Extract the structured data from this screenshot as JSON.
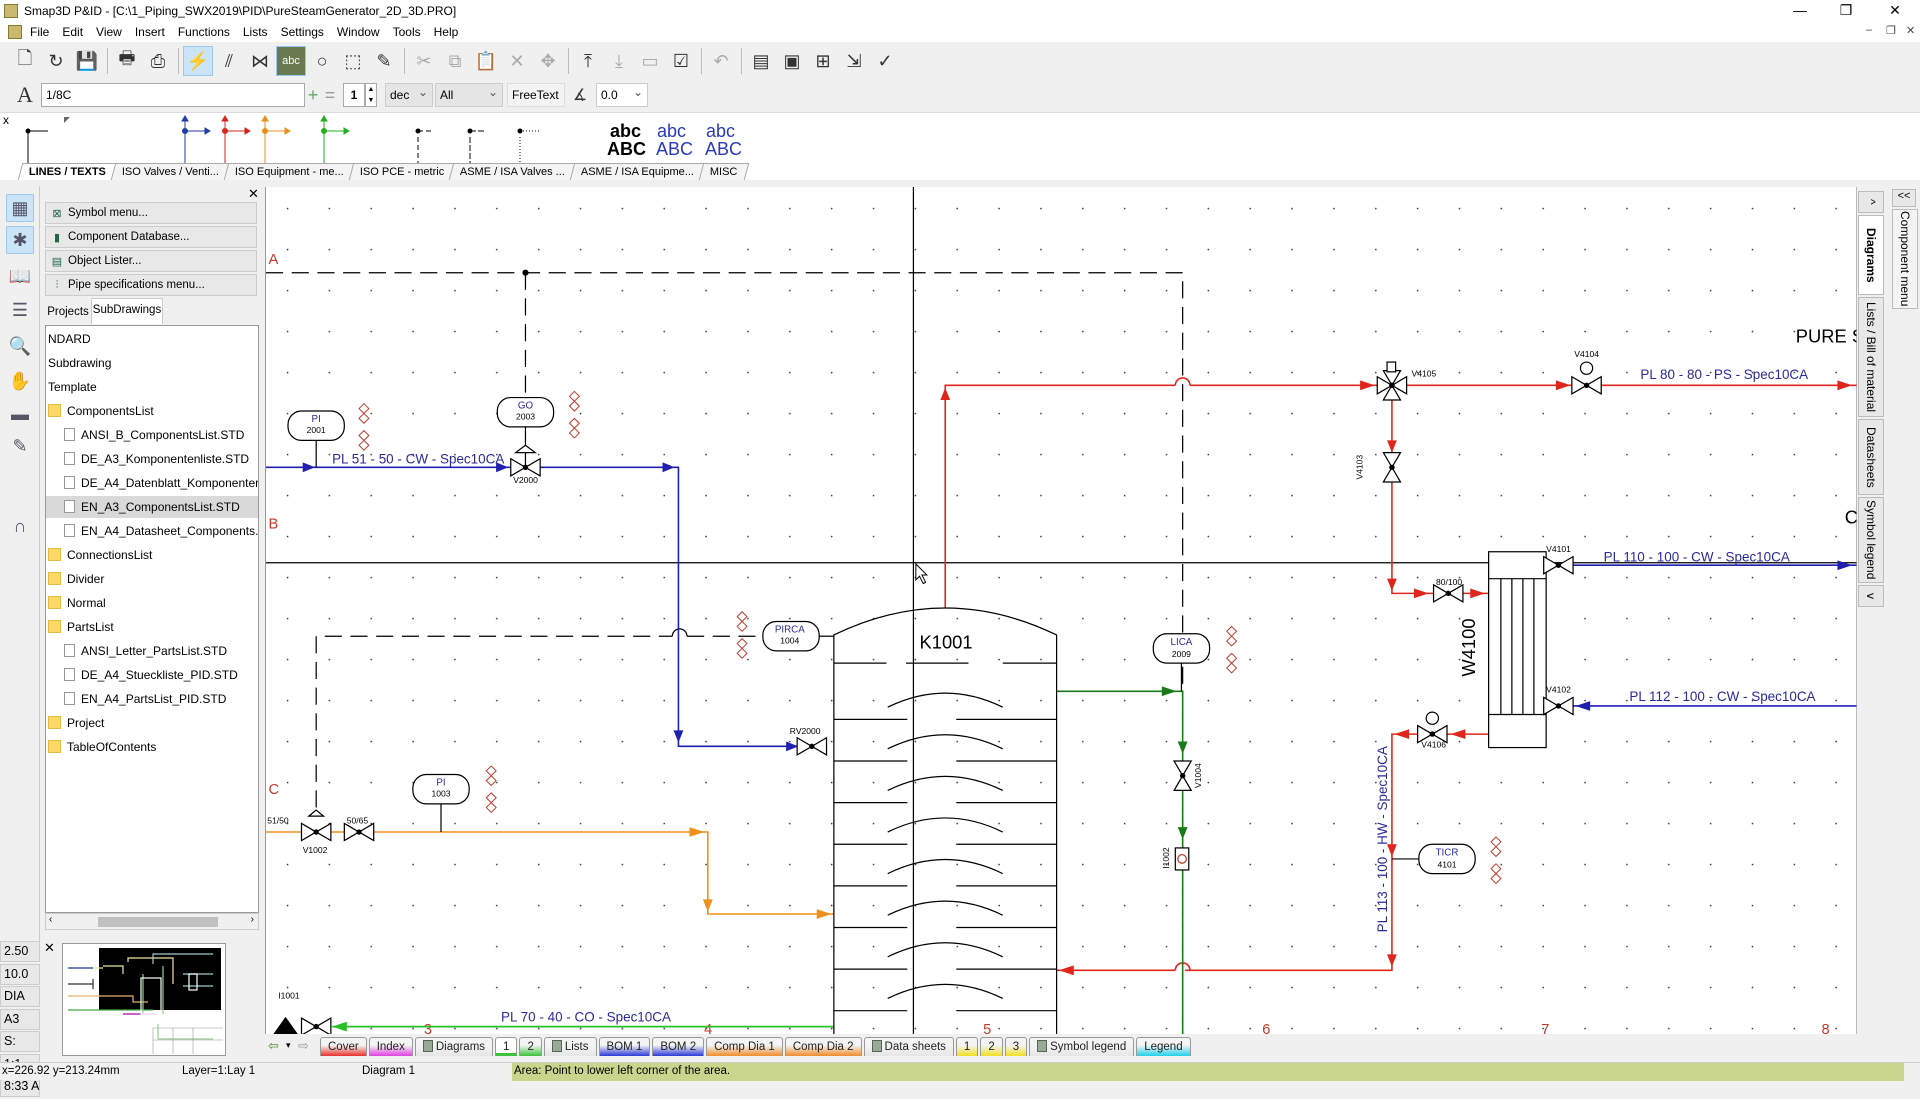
{
  "window": {
    "title": "Smap3D P&ID - [C:\\1_Piping_SWX2019\\PID\\PureSteamGenerator_2D_3D.PRO]",
    "minimize": "—",
    "restore": "❐",
    "close": "✕"
  },
  "menu": [
    "File",
    "Edit",
    "View",
    "Insert",
    "Functions",
    "Lists",
    "Settings",
    "Window",
    "Tools",
    "Help"
  ],
  "toolbar": {
    "icons": [
      {
        "name": "new-document-icon",
        "glyph": "🗋"
      },
      {
        "name": "open-icon",
        "glyph": "↻"
      },
      {
        "name": "save-icon",
        "glyph": "💾"
      },
      {
        "sep": true
      },
      {
        "name": "print-icon",
        "glyph": "🖶"
      },
      {
        "name": "print-preview-icon",
        "glyph": "⎙"
      },
      {
        "sep": true
      },
      {
        "name": "pipe-draw-icon",
        "glyph": "⚡",
        "active": true
      },
      {
        "name": "parallel-lines-icon",
        "glyph": "⫽"
      },
      {
        "name": "valve-icon",
        "glyph": "⋈"
      },
      {
        "name": "text-abc-icon",
        "glyph": "abc",
        "active": true
      },
      {
        "name": "circle-icon",
        "glyph": "○"
      },
      {
        "name": "select-area-icon",
        "glyph": "⬚"
      },
      {
        "name": "pencil-icon",
        "glyph": "✎"
      },
      {
        "sep": true
      },
      {
        "name": "cut-icon",
        "glyph": "✂",
        "dis": true
      },
      {
        "name": "copy-icon",
        "glyph": "⧉",
        "dis": true
      },
      {
        "name": "paste-icon",
        "glyph": "📋"
      },
      {
        "name": "delete-icon",
        "glyph": "✕",
        "dis": true
      },
      {
        "name": "move-icon",
        "glyph": "✥",
        "dis": true
      },
      {
        "sep": true
      },
      {
        "name": "pipe-up-icon",
        "glyph": "⤒"
      },
      {
        "name": "pipe-down-icon",
        "glyph": "⤓",
        "dis": true
      },
      {
        "name": "rectangle-icon",
        "glyph": "▭",
        "dis": true
      },
      {
        "name": "checklist-icon",
        "glyph": "☑"
      },
      {
        "sep": true
      },
      {
        "name": "undo-icon",
        "glyph": "↶",
        "dis": true
      },
      {
        "sep": true
      },
      {
        "name": "document-list-icon",
        "glyph": "▤"
      },
      {
        "name": "database-icon",
        "glyph": "▣"
      },
      {
        "name": "insert-component-icon",
        "glyph": "⊞"
      },
      {
        "name": "export-icon",
        "glyph": "⇲"
      },
      {
        "name": "spellcheck-icon",
        "glyph": "✓"
      }
    ],
    "text_style": "1/8C",
    "counter": "1",
    "number_format": "dec",
    "layer_filter": "All",
    "freetext_label": "FreeText",
    "angle": "0.0"
  },
  "palette": {
    "close": "x",
    "tabs": [
      "LINES / TEXTS",
      "ISO Valves / Venti...",
      "ISO Equipment - me...",
      "ISO PCE - metric",
      "ASME / ISA Valves ...",
      "ASME / ISA Equipme...",
      "MISC"
    ],
    "active_tab": 0,
    "text_samples": [
      {
        "top": "abc",
        "bottom": "ABC"
      },
      {
        "top": "abc",
        "bottom": "ABC"
      },
      {
        "top": "abc",
        "bottom": "ABC"
      }
    ],
    "line_colors": [
      "#000000",
      "#1f3fa8",
      "#d9261c",
      "#e8901c",
      "#22b022"
    ]
  },
  "left_panel": {
    "close": "✕",
    "menu_buttons": [
      "Symbol menu...",
      "Component Database...",
      "Object Lister...",
      "Pipe specifications menu..."
    ],
    "tabs": [
      "Projects",
      "SubDrawings"
    ],
    "active_tab": 1,
    "tree": [
      {
        "label": "NDARD",
        "type": "text",
        "level": 0
      },
      {
        "label": "Subdrawing",
        "type": "text",
        "level": 0
      },
      {
        "label": "Template",
        "type": "text",
        "level": 0
      },
      {
        "label": "ComponentsList",
        "type": "folder",
        "level": 0
      },
      {
        "label": "ANSI_B_ComponentsList.STD",
        "type": "file",
        "level": 1
      },
      {
        "label": "DE_A3_Komponentenliste.STD",
        "type": "file",
        "level": 1
      },
      {
        "label": "DE_A4_Datenblatt_Komponenten",
        "type": "file",
        "level": 1
      },
      {
        "label": "EN_A3_ComponentsList.STD",
        "type": "file",
        "level": 1,
        "selected": true
      },
      {
        "label": "EN_A4_Datasheet_Components.s",
        "type": "file",
        "level": 1
      },
      {
        "label": "ConnectionsList",
        "type": "folder",
        "level": 0
      },
      {
        "label": "Divider",
        "type": "folder",
        "level": 0
      },
      {
        "label": "Normal",
        "type": "folder",
        "level": 0
      },
      {
        "label": "PartsList",
        "type": "folder",
        "level": 0
      },
      {
        "label": "ANSI_Letter_PartsList.STD",
        "type": "file",
        "level": 1
      },
      {
        "label": "DE_A4_Stueckliste_PID.STD",
        "type": "file",
        "level": 1
      },
      {
        "label": "EN_A4_PartsList_PID.STD",
        "type": "file",
        "level": 1
      },
      {
        "label": "Project",
        "type": "folder",
        "level": 0
      },
      {
        "label": "TableOfContents",
        "type": "folder",
        "level": 0
      }
    ]
  },
  "side_values": [
    "2.50",
    "10.0",
    "DIA",
    "A3",
    "S:",
    "1:1",
    "8:33 A"
  ],
  "overview_close": "✕",
  "right_tabs": {
    "up": "^",
    "down": "v",
    "tabs": [
      "Diagrams",
      "Lists / Bill of material",
      "Datasheets",
      "Symbol legend"
    ],
    "active": 0,
    "collapse": "<<",
    "component_menu": "Component menu"
  },
  "drawing": {
    "rows": [
      "A",
      "B",
      "C"
    ],
    "columns": [
      "3",
      "4",
      "5",
      "6",
      "7",
      "8"
    ],
    "title_fragment": "PURE S",
    "row_fragment": "C",
    "equipment": {
      "column": "K1001",
      "heat_exchanger": "W4100"
    },
    "pipelines": {
      "pl51": "PL 51 - 50 - CW - Spec10CA",
      "pl80": "PL 80 - 80 - PS - Spec10CA",
      "pl110": "PL 110 - 100 - CW - Spec10CA",
      "pl112": "PL 112 - 100 - CW - Spec10CA",
      "pl113": "PL 113 - 100 - HW - Spec10CA",
      "pl70": "PL 70 - 40 - CO - Spec10CA"
    },
    "instruments": {
      "pi2001": {
        "tag": "PI",
        "num": "2001"
      },
      "go2003": {
        "tag": "GO",
        "num": "2003"
      },
      "pirca1004": {
        "tag": "PIRCA",
        "num": "1004"
      },
      "lica2009": {
        "tag": "LICA",
        "num": "2009"
      },
      "pi1003": {
        "tag": "PI",
        "num": "1003"
      },
      "ticr4101": {
        "tag": "TICR",
        "num": "4101"
      }
    },
    "valves": {
      "v2000": "V2000",
      "v4105": "V4105",
      "v4104": "V4104",
      "v4103": "V4103",
      "v4101": "V4101",
      "v4102": "V4102",
      "v4106": "V4106",
      "rv2000": "RV2000",
      "v1004": "V1004",
      "i1002": "I1002",
      "v1002": "V1002",
      "i1001": "I1001",
      "red8100": "80/100",
      "red5065": "50/65",
      "red5150": "51/50"
    },
    "colors": {
      "cw": "#1f1fb0",
      "ps": "#e0261c",
      "co": "#1fa81f",
      "orange": "#f0901c",
      "green_dark": "#1a7a1a",
      "label": "#2a2a9a",
      "grid_letter": "#c0392b"
    }
  },
  "sheet_tabs": [
    {
      "label": "Cover",
      "color": "#e8302a"
    },
    {
      "label": "Index",
      "color": "#e040e0"
    },
    {
      "label": "Diagrams",
      "color": "#e6e6e6",
      "book": true
    },
    {
      "label": "1",
      "color": "#3ac43a",
      "active": true
    },
    {
      "label": "2",
      "color": "#3ac43a"
    },
    {
      "label": "Lists",
      "color": "#e6e6e6",
      "book": true
    },
    {
      "label": "BOM 1",
      "color": "#2a3ad8"
    },
    {
      "label": "BOM 2",
      "color": "#2a3ad8"
    },
    {
      "label": "Comp Dia 1",
      "color": "#f08c2a"
    },
    {
      "label": "Comp Dia 2",
      "color": "#f08c2a"
    },
    {
      "label": "Data sheets",
      "color": "#e6e6e6",
      "book": true
    },
    {
      "label": "1",
      "color": "#f0e020"
    },
    {
      "label": "2",
      "color": "#f0e020"
    },
    {
      "label": "3",
      "color": "#f0e020"
    },
    {
      "label": "Symbol legend",
      "color": "#e6e6e6",
      "book": true
    },
    {
      "label": "Legend",
      "color": "#20d0e8"
    }
  ],
  "status": {
    "coords": "x=226.92 y=213.24mm",
    "layer": "Layer=1:Lay 1",
    "diagram": "Diagram 1",
    "hint": "Area: Point to lower left corner of the area."
  }
}
